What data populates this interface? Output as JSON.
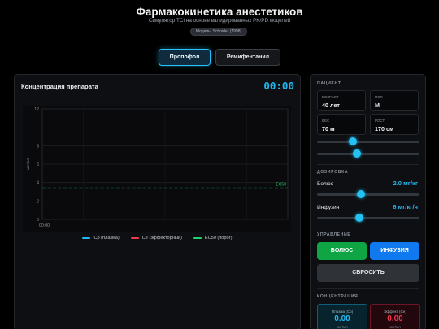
{
  "header": {
    "title": "Фармакокинетика анестетиков",
    "subtitle": "Симулятор TCI на основе валидированных PK/PD моделей",
    "model_badge": "Модель: Schnider (1998)"
  },
  "drug_tabs": [
    {
      "label": "Пропофол",
      "active": true
    },
    {
      "label": "Ремифентанил",
      "active": false
    }
  ],
  "chart_panel": {
    "title": "Концентрация препарата",
    "timer": "00:00"
  },
  "chart_data": {
    "type": "line",
    "ylabel": "мкг/мл",
    "ylim": [
      0,
      12
    ],
    "yticks": [
      "12",
      "8",
      "6",
      "4",
      "2",
      "0"
    ],
    "xticks": [
      "00:00"
    ],
    "grid": true,
    "legend_placement": "bottom",
    "series": [
      {
        "name": "Cp (плазма)",
        "color": "#22b8f0",
        "values": []
      },
      {
        "name": "Ce (эффекторный)",
        "color": "#f0384f",
        "values": []
      },
      {
        "name": "EC50 (порог)",
        "color": "#22d36b",
        "values": [
          3.4
        ],
        "dashed": true
      }
    ],
    "annotations": [
      {
        "text": "EC50",
        "y": 3.4,
        "color": "#22d36b"
      }
    ]
  },
  "patient": {
    "section_title": "ПАЦИЕНТ",
    "age_label": "ВОЗРАСТ",
    "age_value": "40 лет",
    "sex_label": "ПОЛ",
    "sex_value": "М",
    "weight_label": "ВЕС",
    "weight_value": "70 кг",
    "height_label": "РОСТ",
    "height_value": "170 см",
    "slider1_level": 0.35,
    "slider2_level": 0.39
  },
  "dosing": {
    "section_title": "ДОЗИРОВКА",
    "bolus_label": "Болюс",
    "bolus_value": "2.0 мг/кг",
    "bolus_level": 0.43,
    "infusion_label": "Инфузия",
    "infusion_value": "6 мг/кг/ч",
    "infusion_level": 0.41
  },
  "control": {
    "section_title": "УПРАВЛЕНИЕ",
    "bolus_button": "БОЛЮС",
    "infusion_button": "ИНФУЗИЯ",
    "reset_button": "СБРОСИТЬ"
  },
  "concentration": {
    "section_title": "КОНЦЕНТРАЦИЯ",
    "plasma_label": "Плазма (Cp)",
    "plasma_value": "0.00",
    "plasma_unit": "мкг/мл",
    "plasma_color": "#22b8f0",
    "effect_label": "Эффект (Ce)",
    "effect_value": "0.00",
    "effect_unit": "мкг/мл",
    "effect_color": "#f0384f"
  }
}
